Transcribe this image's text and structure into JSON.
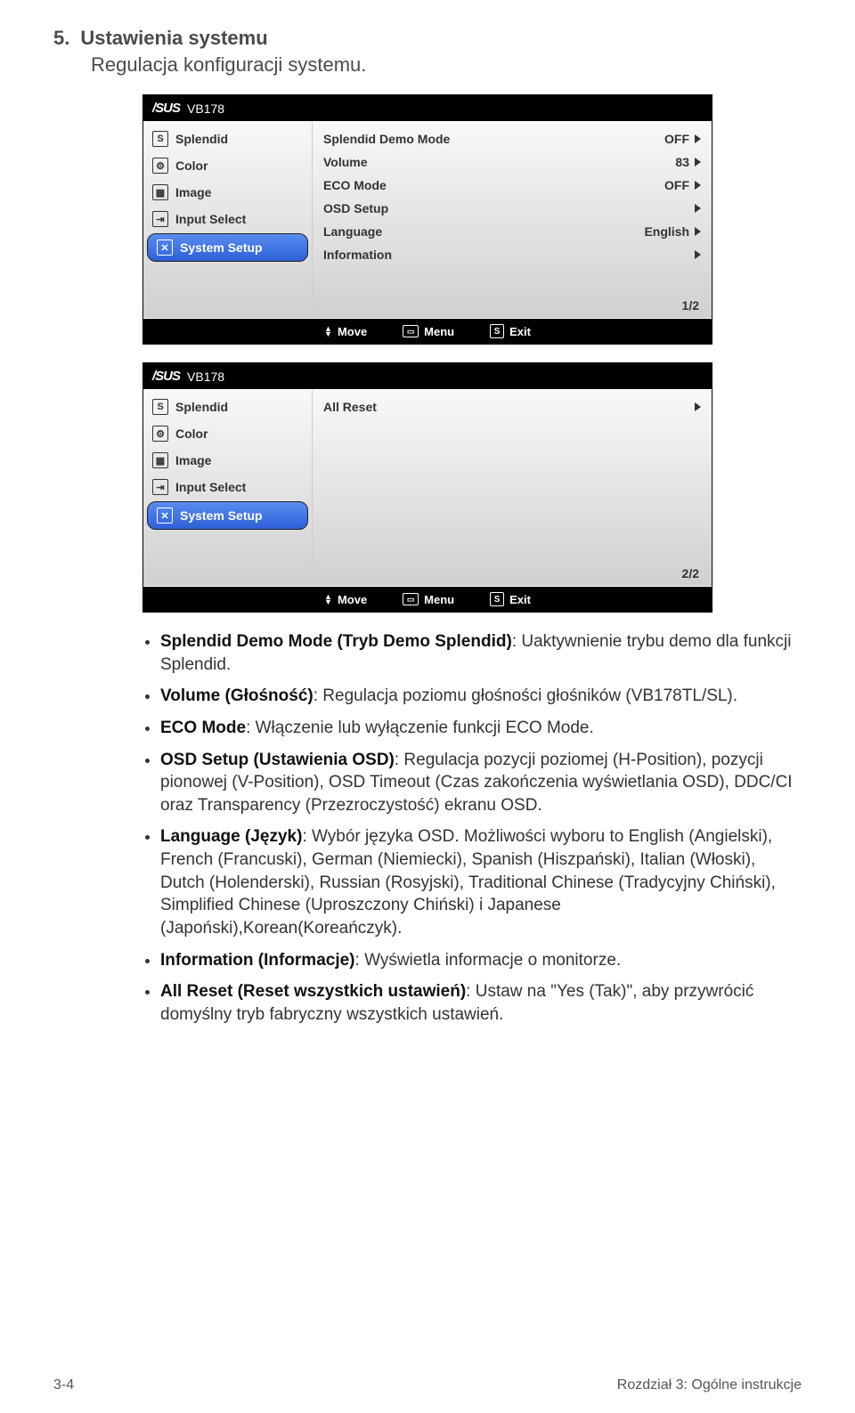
{
  "section": {
    "number": "5.",
    "title": "Ustawienia systemu",
    "subtitle": "Regulacja konfiguracji systemu."
  },
  "osd1": {
    "model": "VB178",
    "sidebar": [
      {
        "icon": "S",
        "label": "Splendid"
      },
      {
        "icon": "⚙",
        "label": "Color"
      },
      {
        "icon": "▦",
        "label": "Image"
      },
      {
        "icon": "⇥",
        "label": "Input Select"
      },
      {
        "icon": "✕",
        "label": "System Setup"
      }
    ],
    "rows": [
      {
        "label": "Splendid Demo Mode",
        "value": "OFF"
      },
      {
        "label": "Volume",
        "value": "83"
      },
      {
        "label": "ECO Mode",
        "value": "OFF"
      },
      {
        "label": "OSD Setup",
        "value": ""
      },
      {
        "label": "Language",
        "value": "English"
      },
      {
        "label": "Information",
        "value": ""
      }
    ],
    "page": "1/2",
    "footer": {
      "move": "Move",
      "menu": "Menu",
      "exit": "Exit"
    }
  },
  "osd2": {
    "model": "VB178",
    "sidebar": [
      {
        "icon": "S",
        "label": "Splendid"
      },
      {
        "icon": "⚙",
        "label": "Color"
      },
      {
        "icon": "▦",
        "label": "Image"
      },
      {
        "icon": "⇥",
        "label": "Input Select"
      },
      {
        "icon": "✕",
        "label": "System Setup"
      }
    ],
    "rows": [
      {
        "label": "All Reset",
        "value": ""
      }
    ],
    "page": "2/2",
    "footer": {
      "move": "Move",
      "menu": "Menu",
      "exit": "Exit"
    }
  },
  "bullets": [
    {
      "b": "Splendid Demo Mode (Tryb Demo Splendid)",
      "t": ": Uaktywnienie trybu demo dla funkcji Splendid."
    },
    {
      "b": "Volume (Głośność)",
      "t": ": Regulacja poziomu głośności głośników (VB178TL/SL)."
    },
    {
      "b": "ECO Mode",
      "t": ": Włączenie lub wyłączenie funkcji ECO Mode."
    },
    {
      "b": "OSD Setup (Ustawienia OSD)",
      "t": ": Regulacja pozycji poziomej (H-Position), pozycji pionowej (V-Position), OSD Timeout (Czas zakończenia wyświetlania OSD), DDC/CI oraz Transparency (Przezroczystość) ekranu OSD."
    },
    {
      "b": "Language (Język)",
      "t": ": Wybór języka OSD. Możliwości wyboru to English (Angielski), French (Francuski), German (Niemiecki), Spanish (Hiszpański), Italian (Włoski), Dutch (Holenderski), Russian (Rosyjski), Traditional Chinese (Tradycyjny Chiński), Simplified Chinese (Uproszczony Chiński) i Japanese (Japoński),Korean(Koreańczyk)."
    },
    {
      "b": "Information (Informacje)",
      "t": ": Wyświetla informacje o monitorze."
    },
    {
      "b": "All Reset (Reset wszystkich ustawień)",
      "t": ": Ustaw na \"Yes (Tak)\", aby przywrócić domyślny tryb fabryczny wszystkich ustawień."
    }
  ],
  "footer": {
    "left": "3-4",
    "right": "Rozdział 3: Ogólne instrukcje"
  }
}
